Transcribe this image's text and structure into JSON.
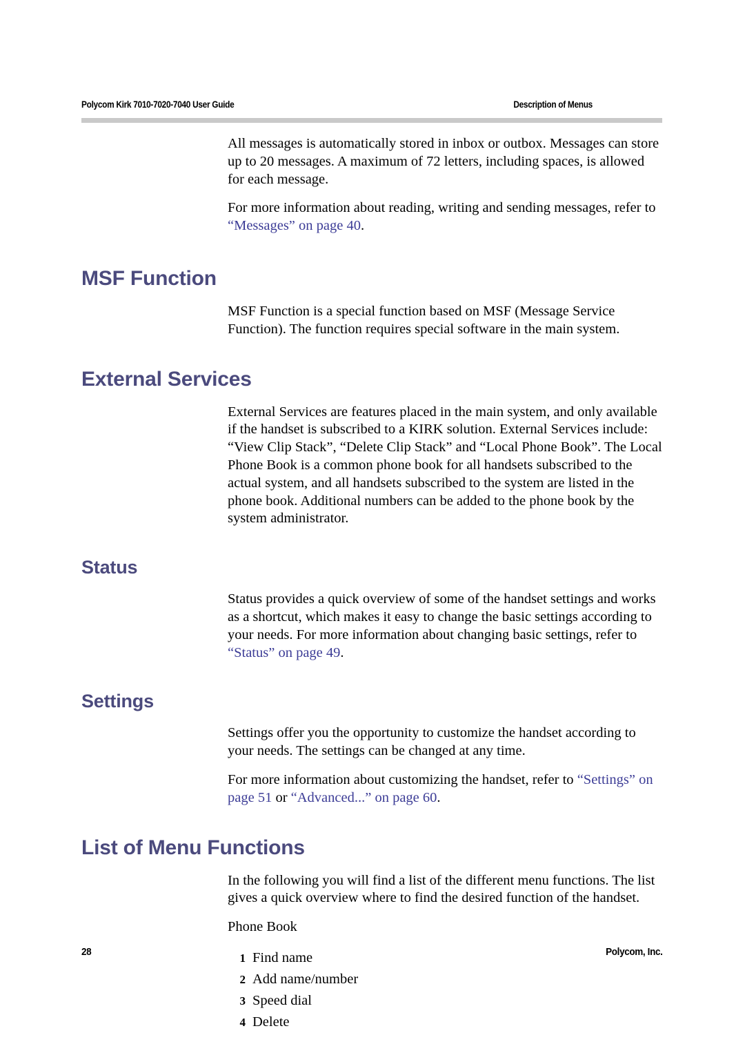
{
  "header": {
    "left": "Polycom Kirk 7010-7020-7040 User Guide",
    "right": "Description of Menus"
  },
  "footer": {
    "page_number": "28",
    "imprint": "Polycom, Inc."
  },
  "colors": {
    "heading": "#4b4a7d",
    "cross_reference": "#3c3c96",
    "header_rule": "#c9c9c9",
    "body_text": "#000000"
  },
  "intro": {
    "paragraph_1": "All messages is automatically stored in inbox or outbox. Messages can store up to 20 messages. A maximum of 72 letters, including spaces, is allowed for each message.",
    "paragraph_2_lead": "For more information about reading, writing and sending messages, refer to ",
    "paragraph_2_link": "“Messages” on page 40",
    "paragraph_2_tail": "."
  },
  "sections": [
    {
      "heading": "MSF Function",
      "paragraph_1": "MSF Function is a special function based on MSF (Message Service Function). The function requires special software in the main system."
    },
    {
      "heading": "External Services",
      "paragraph_1": "External Services are features placed in the main system, and only available if the handset is subscribed to a KIRK solution. External Services include: “View Clip Stack”, “Delete Clip Stack” and “Local Phone Book”. The Local Phone Book is a common phone book for all handsets subscribed to the actual system, and all handsets subscribed to the system are listed in the phone book. Additional numbers can be added to the phone book by the system administrator."
    },
    {
      "heading": "Status",
      "paragraph_1_lead": "Status provides a quick overview of some of the handset settings and works as a shortcut, which makes it easy to change the basic settings according to your needs. For more information about changing basic settings, refer to ",
      "paragraph_1_link": "“Status” on page 49",
      "paragraph_1_tail": "."
    },
    {
      "heading": "Settings",
      "paragraph_1": "Settings offer you the opportunity to customize the handset according to your needs. The settings can be changed at any time.",
      "paragraph_2_lead": "For more information about customizing the handset, refer to ",
      "paragraph_2_link_1": "“Settings” on page 51",
      "paragraph_2_mid": " or ",
      "paragraph_2_link_2": "“Advanced...” on page 60",
      "paragraph_2_tail": "."
    },
    {
      "heading": "List of Menu Functions",
      "paragraph_1": "In the following you will find a list of the different menu functions. The list gives a quick overview where to find the desired function of the handset.",
      "paragraph_2": "Phone Book",
      "menu_items": [
        {
          "number": "1",
          "label": "Find name"
        },
        {
          "number": "2",
          "label": "Add name/number"
        },
        {
          "number": "3",
          "label": "Speed dial"
        },
        {
          "number": "4",
          "label": "Delete"
        }
      ]
    }
  ]
}
